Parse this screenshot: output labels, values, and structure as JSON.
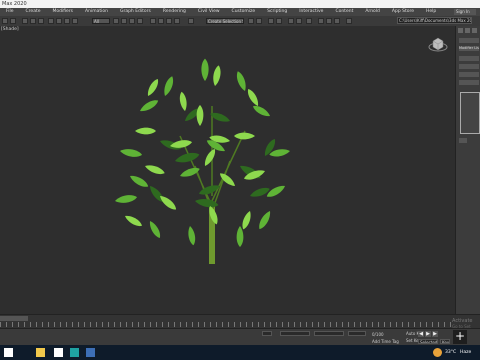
{
  "window": {
    "title": "Max 2020"
  },
  "menu": {
    "items": [
      "File",
      "Create",
      "Modifiers",
      "Animation",
      "Graph Editors",
      "Rendering",
      "Civil View",
      "Customize",
      "Scripting",
      "Interactive",
      "Content",
      "Arnold",
      "App Store",
      "Help"
    ],
    "sign_in": "Sign In"
  },
  "toolbar": {
    "filter_value": "All",
    "selection_set": "Create Selection Se",
    "project_path": "C:\\Users\\Kiff\\Documents\\3ds Max 2020"
  },
  "viewport": {
    "label": "[Shade]"
  },
  "command_panel": {
    "modifier_list": "Modifier List"
  },
  "status": {
    "coord": "0/100",
    "add_time_tag": "Add Time Tag",
    "auto_key": "Auto Key",
    "selected": "Selected",
    "set_key": "Set Key",
    "key_filters": "Key Filters"
  },
  "watermark": {
    "line1": "Activate",
    "line2": "Go to Set"
  },
  "taskbar": {
    "weather_temp": "33°C",
    "weather_desc": "Haze"
  },
  "colors": {
    "leaf_light": "#8ed94e",
    "leaf_mid": "#5fb336",
    "leaf_dark": "#2e6a1f",
    "stem": "#6f9a2e",
    "viewport_bg": "#2e2e2e"
  }
}
